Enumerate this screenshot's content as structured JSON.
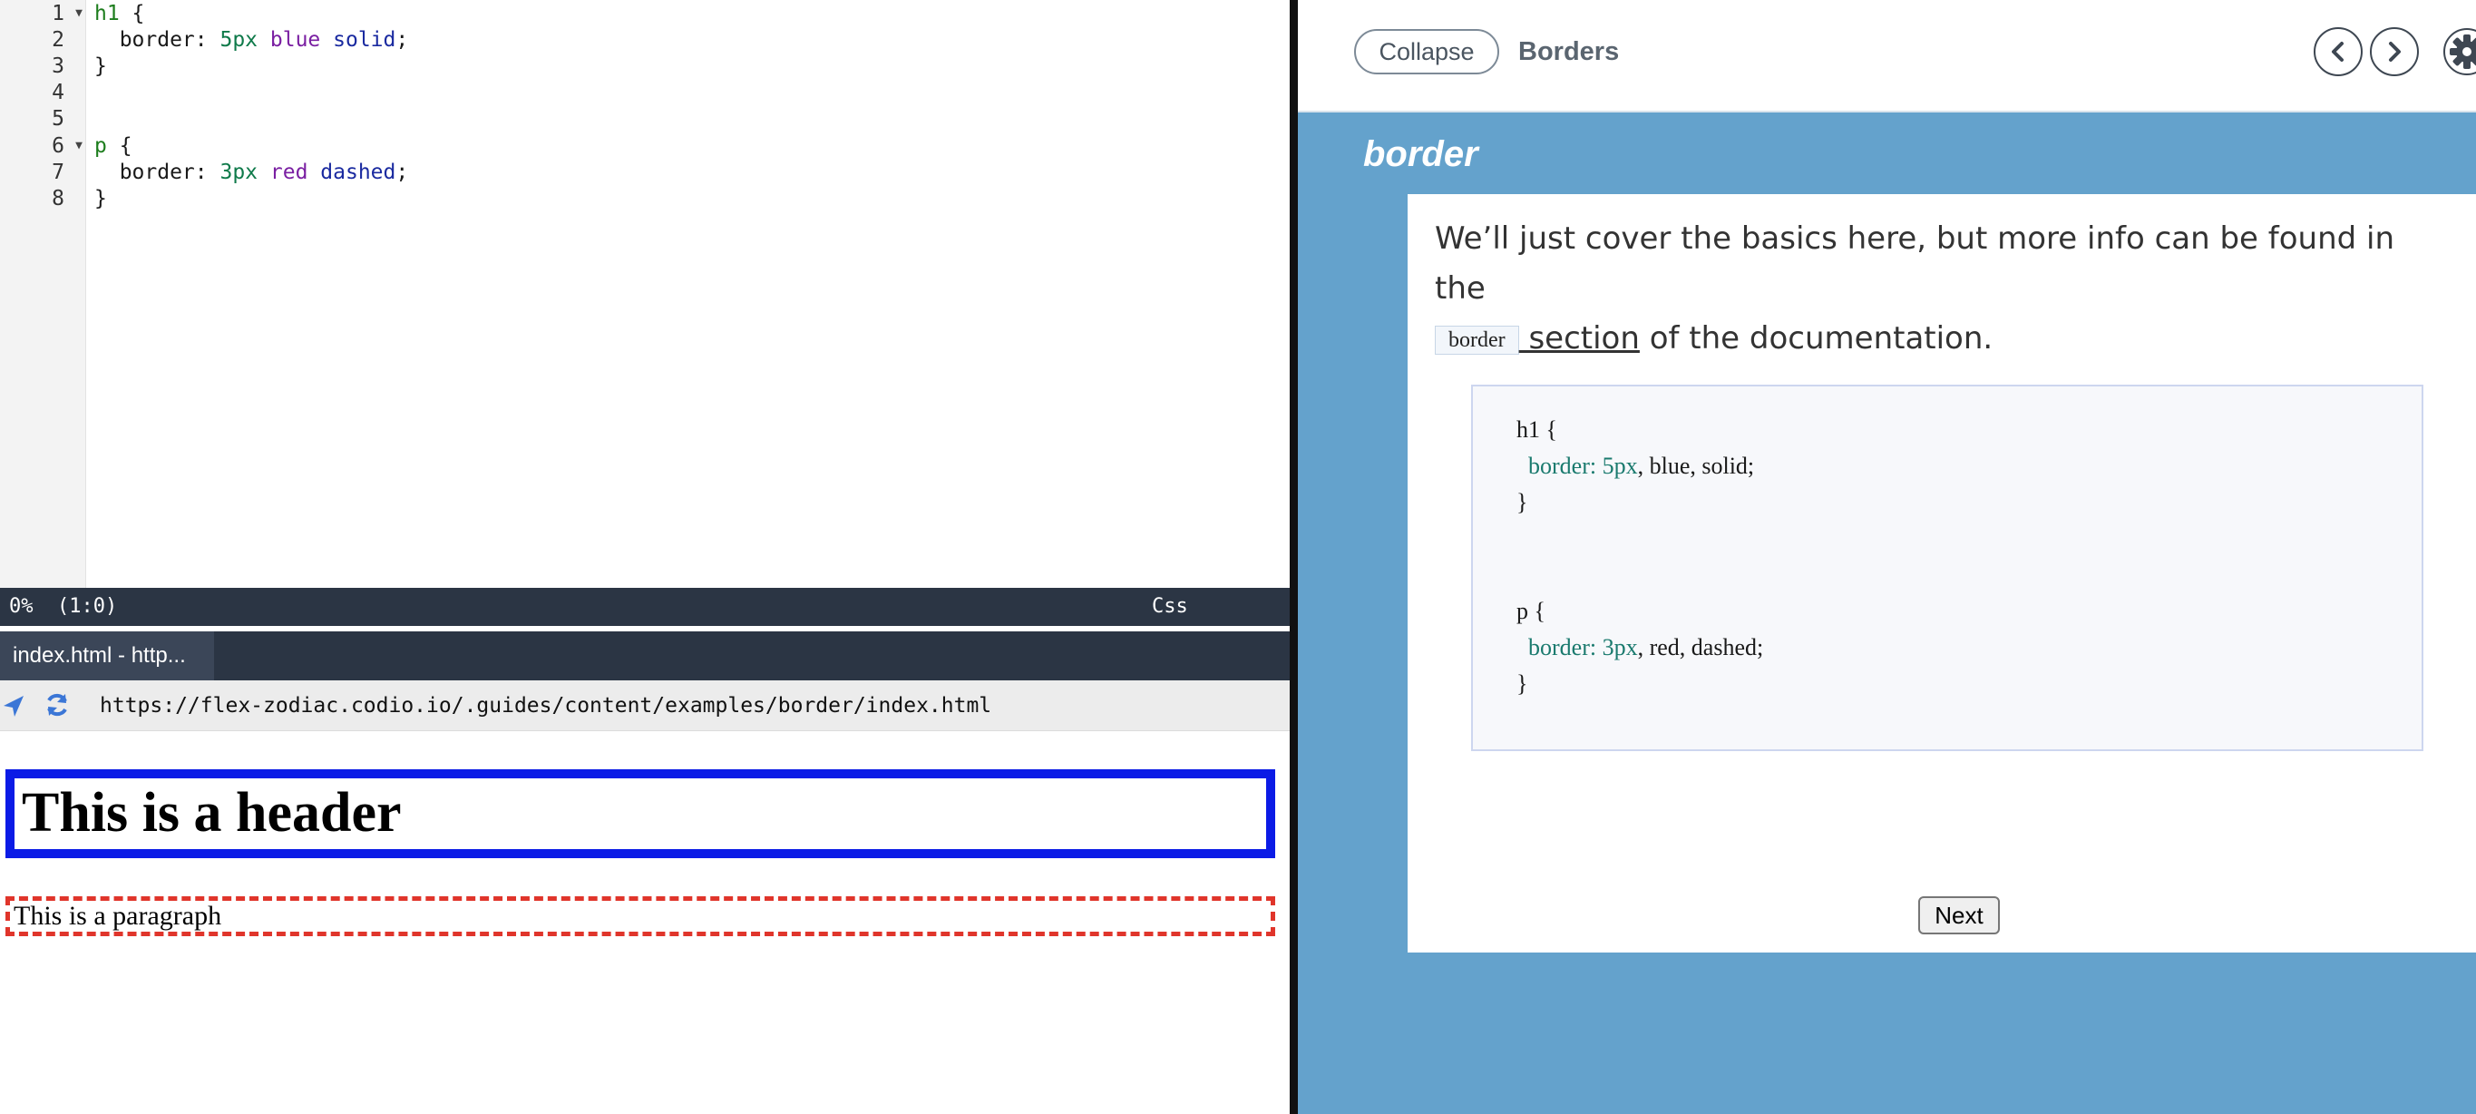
{
  "editor": {
    "lines": [
      {
        "num": "1",
        "foldable": true,
        "tokens": [
          {
            "t": "h1",
            "c": "sel"
          },
          {
            "t": " {",
            "c": ""
          }
        ]
      },
      {
        "num": "2",
        "foldable": false,
        "tokens": [
          {
            "t": "  border: ",
            "c": ""
          },
          {
            "t": "5px",
            "c": "num"
          },
          {
            "t": " ",
            "c": ""
          },
          {
            "t": "blue",
            "c": "kw"
          },
          {
            "t": " ",
            "c": ""
          },
          {
            "t": "solid",
            "c": "kw2"
          },
          {
            "t": ";",
            "c": ""
          }
        ]
      },
      {
        "num": "3",
        "foldable": false,
        "tokens": [
          {
            "t": "}",
            "c": ""
          }
        ]
      },
      {
        "num": "4",
        "foldable": false,
        "tokens": []
      },
      {
        "num": "5",
        "foldable": false,
        "tokens": []
      },
      {
        "num": "6",
        "foldable": true,
        "tokens": [
          {
            "t": "p",
            "c": "sel"
          },
          {
            "t": " {",
            "c": ""
          }
        ]
      },
      {
        "num": "7",
        "foldable": false,
        "tokens": [
          {
            "t": "  border: ",
            "c": ""
          },
          {
            "t": "3px",
            "c": "num"
          },
          {
            "t": " ",
            "c": ""
          },
          {
            "t": "red",
            "c": "kw"
          },
          {
            "t": " ",
            "c": ""
          },
          {
            "t": "dashed",
            "c": "kw2"
          },
          {
            "t": ";",
            "c": ""
          }
        ]
      },
      {
        "num": "8",
        "foldable": false,
        "tokens": [
          {
            "t": "}",
            "c": ""
          }
        ]
      }
    ],
    "fold_icon": "triangle-down-icon"
  },
  "status_bar": {
    "position": "0%  (1:0)",
    "language": "Css"
  },
  "preview": {
    "tab_label": "index.html - http...",
    "nav_icon": "location-arrow-icon",
    "refresh_icon": "refresh-icon",
    "url": "https://flex-zodiac.codio.io/.guides/content/examples/border/index.html",
    "header_text": "This is a header",
    "paragraph_text": "This is a paragraph",
    "header_border_color": "#0b1be6",
    "paragraph_border_color": "#e0352b"
  },
  "guide": {
    "collapse_label": "Collapse",
    "title": "Borders",
    "prev_icon": "chevron-left-icon",
    "next_icon": "chevron-right-icon",
    "settings_icon": "gear-icon",
    "section_heading": "border",
    "intro_before": "We’ll just cover the basics here, but more info can be found in the",
    "chip_label": "border",
    "link_text": " section",
    "intro_after": " of the documentation.",
    "code_sample": [
      {
        "plain": "h1 {",
        "prop": "",
        "rest": ""
      },
      {
        "plain": "  ",
        "prop": "border: 5px",
        "rest": ", blue, solid;"
      },
      {
        "plain": "}",
        "prop": "",
        "rest": ""
      },
      {
        "plain": "p {",
        "prop": "",
        "rest": ""
      },
      {
        "plain": "  ",
        "prop": "border: 3px",
        "rest": ", red, dashed;"
      },
      {
        "plain": "}",
        "prop": "",
        "rest": ""
      }
    ],
    "next_button": "Next",
    "accent_color": "#64a2cc"
  }
}
